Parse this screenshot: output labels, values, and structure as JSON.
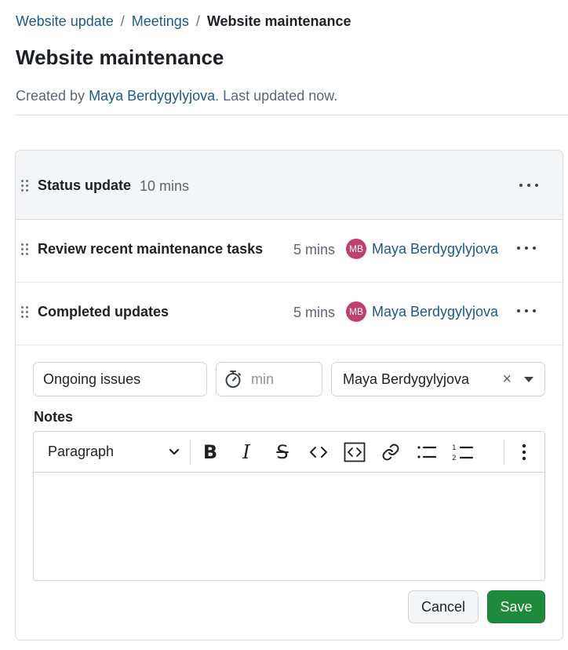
{
  "breadcrumb": {
    "items": [
      "Website update",
      "Meetings"
    ],
    "current": "Website maintenance",
    "separator": "/"
  },
  "page": {
    "title": "Website maintenance",
    "meta_prefix": "Created by ",
    "meta_author": "Maya Berdygylyjova",
    "meta_suffix": ". Last updated now."
  },
  "agenda": {
    "section": {
      "title": "Status update",
      "duration": "10 mins"
    },
    "items": [
      {
        "title": "Review recent maintenance tasks",
        "duration": "5 mins",
        "presenter_initials": "MB",
        "presenter": "Maya Berdygylyjova"
      },
      {
        "title": "Completed updates",
        "duration": "5 mins",
        "presenter_initials": "MB",
        "presenter": "Maya Berdygylyjova"
      }
    ]
  },
  "form": {
    "title_value": "Ongoing issues",
    "duration_placeholder": "min",
    "presenter_value": "Maya Berdygylyjova",
    "clear_symbol": "×",
    "notes_label": "Notes",
    "format_value": "Paragraph",
    "cancel_label": "Cancel",
    "save_label": "Save"
  },
  "toolbar_icons": [
    "bold-icon",
    "italic-icon",
    "strikethrough-icon",
    "inline-code-icon",
    "code-block-icon",
    "link-icon",
    "bullet-list-icon",
    "numbered-list-icon",
    "more-vertical-icon"
  ],
  "colors": {
    "link": "#1c5a8a",
    "avatar": "#c13f6e",
    "save_button": "#1d8a3c",
    "section_background": "#f4f5f7"
  }
}
